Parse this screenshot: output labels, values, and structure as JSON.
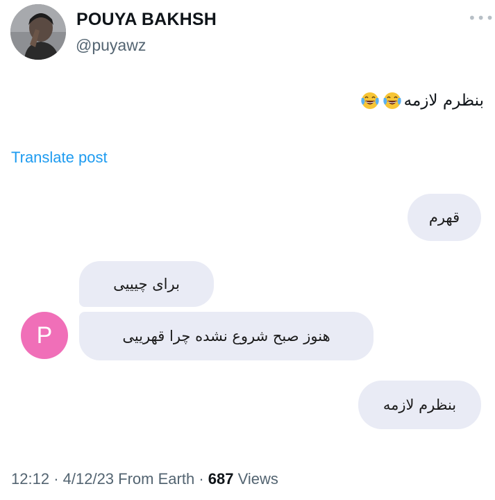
{
  "author": {
    "display_name": "POUYA BAKHSH",
    "handle": "@puyawz",
    "more_icon": "more-horizontal-icon"
  },
  "tweet": {
    "text": "بنظرم لازمه",
    "emoji": [
      "face-with-tears-of-joy",
      "face-with-tears-of-joy"
    ],
    "translate_label": "Translate post"
  },
  "chat": {
    "messages": [
      {
        "side": "outgoing",
        "text": "قهرم"
      },
      {
        "side": "incoming",
        "text": "برای چیییی"
      },
      {
        "side": "incoming",
        "text": "هنوز صبح شروع نشده چرا قهرییی"
      },
      {
        "side": "outgoing",
        "text": "بنظرم لازمه"
      }
    ],
    "contact_initial": "P",
    "contact_avatar_color": "#f06fb8"
  },
  "footer": {
    "time": "12:12",
    "date": "4/12/23",
    "source": "From Earth",
    "views_count": "687",
    "views_label": "Views"
  },
  "colors": {
    "link": "#1d9bf0",
    "bubble": "#e9ebf5",
    "muted": "#536471"
  }
}
